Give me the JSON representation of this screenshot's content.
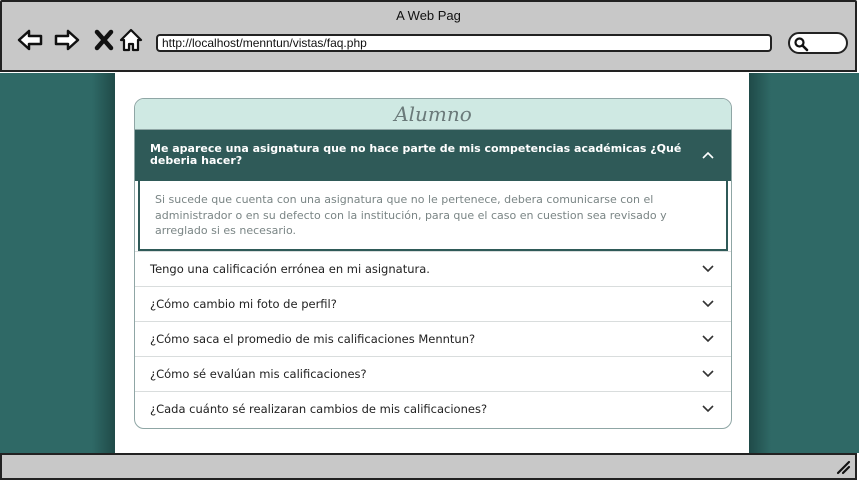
{
  "window": {
    "title": "A Web Pag"
  },
  "address_bar": {
    "url": "http://localhost/menntun/vistas/faq.php"
  },
  "icons": {
    "back": "arrow-left-icon",
    "forward": "arrow-right-icon",
    "close": "close-icon",
    "home": "home-icon",
    "search": "search-icon",
    "chevron_up": "chevron-up-icon",
    "chevron_down": "chevron-down-icon",
    "resize": "resize-grip-icon"
  },
  "colors": {
    "viewport_bg": "#2f6966",
    "card_header_bg": "#cfe9e3",
    "open_question_bg": "#2f5a58",
    "chrome_gray": "#c8c8c8"
  },
  "faq": {
    "section_title": "Alumno",
    "open_item": {
      "question": "Me aparece una asignatura que no hace parte de mis competencias académicas ¿Qué deberia hacer?",
      "answer": "Si sucede que cuenta con una asignatura que no le pertenece, debera comunicarse con el administrador o en su defecto con la institución, para que el caso en cuestion sea revisado y arreglado si es necesario."
    },
    "items": [
      {
        "question": "Tengo una calificación errónea en mi asignatura."
      },
      {
        "question": "¿Cómo cambio mi foto de perfil?"
      },
      {
        "question": "¿Cómo saca el promedio de mis calificaciones Menntun?"
      },
      {
        "question": "¿Cómo sé evalúan mis calificaciones?"
      },
      {
        "question": "¿Cada cuánto sé realizaran cambios de mis calificaciones?"
      }
    ]
  }
}
